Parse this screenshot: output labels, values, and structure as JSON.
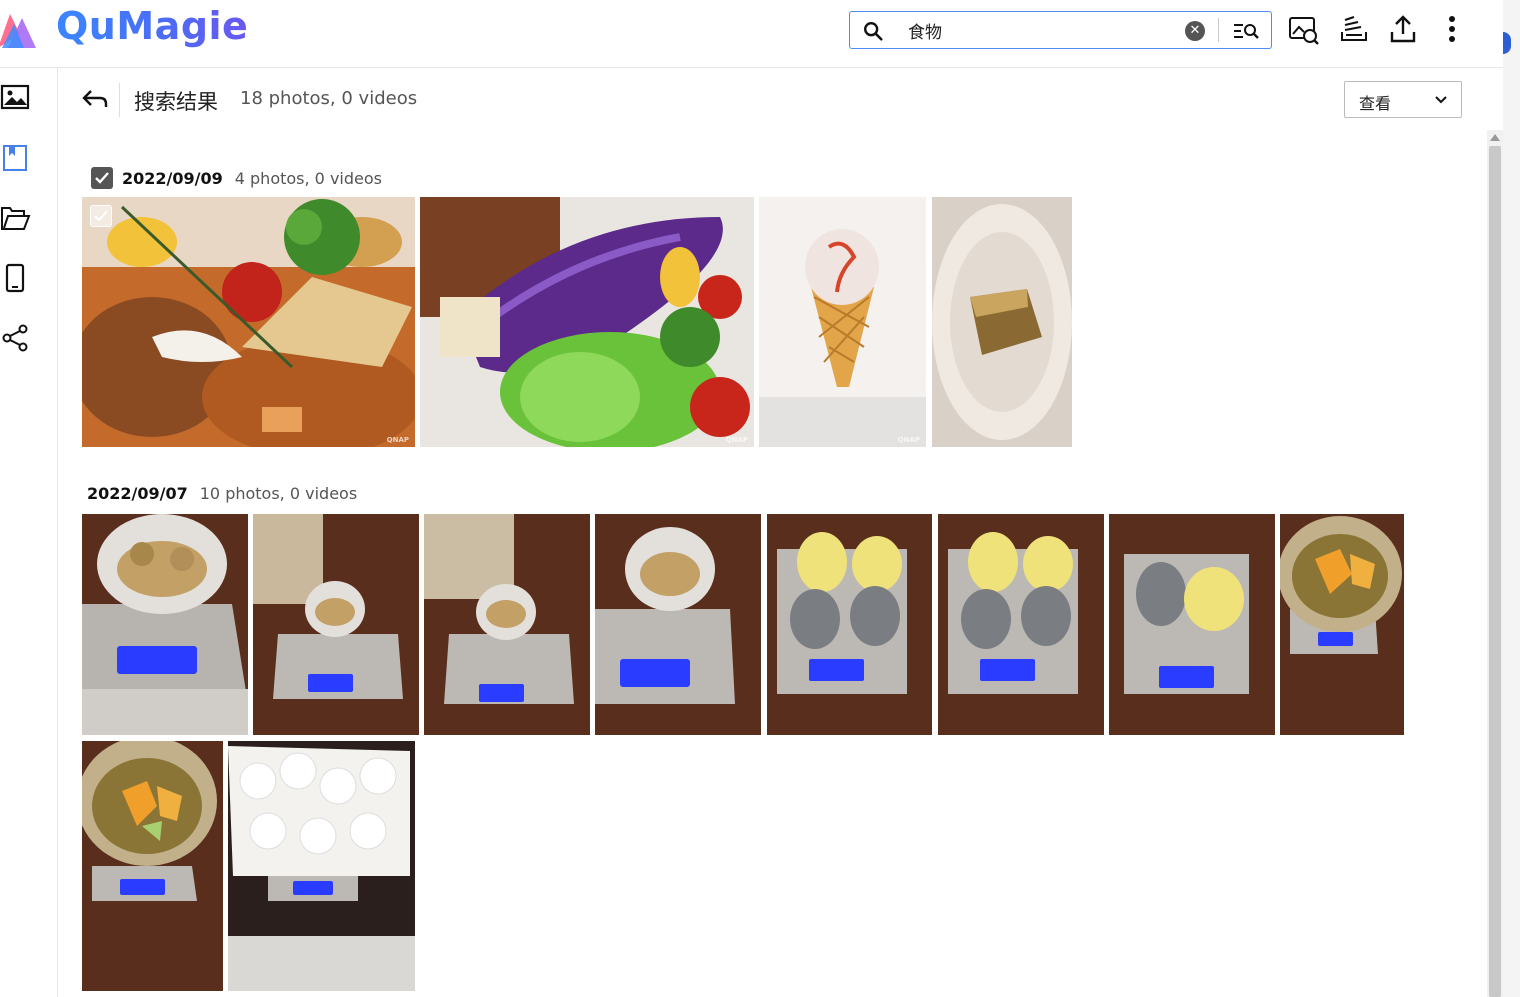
{
  "app": {
    "name": "QuMagie"
  },
  "search": {
    "value": "食物",
    "placeholder": ""
  },
  "header": {
    "title": "搜索结果",
    "count": "18 photos, 0 videos"
  },
  "view_select": {
    "value": "查看"
  },
  "groups": [
    {
      "date": "2022/09/09",
      "count": "4 photos, 0 videos"
    },
    {
      "date": "2022/09/07",
      "count": "10 photos, 0 videos"
    }
  ],
  "watermark": "QNAP",
  "colors": {
    "accent": "#3a86ff",
    "nav_active": "#4a7ee8",
    "lcd": "#2a3cff"
  }
}
